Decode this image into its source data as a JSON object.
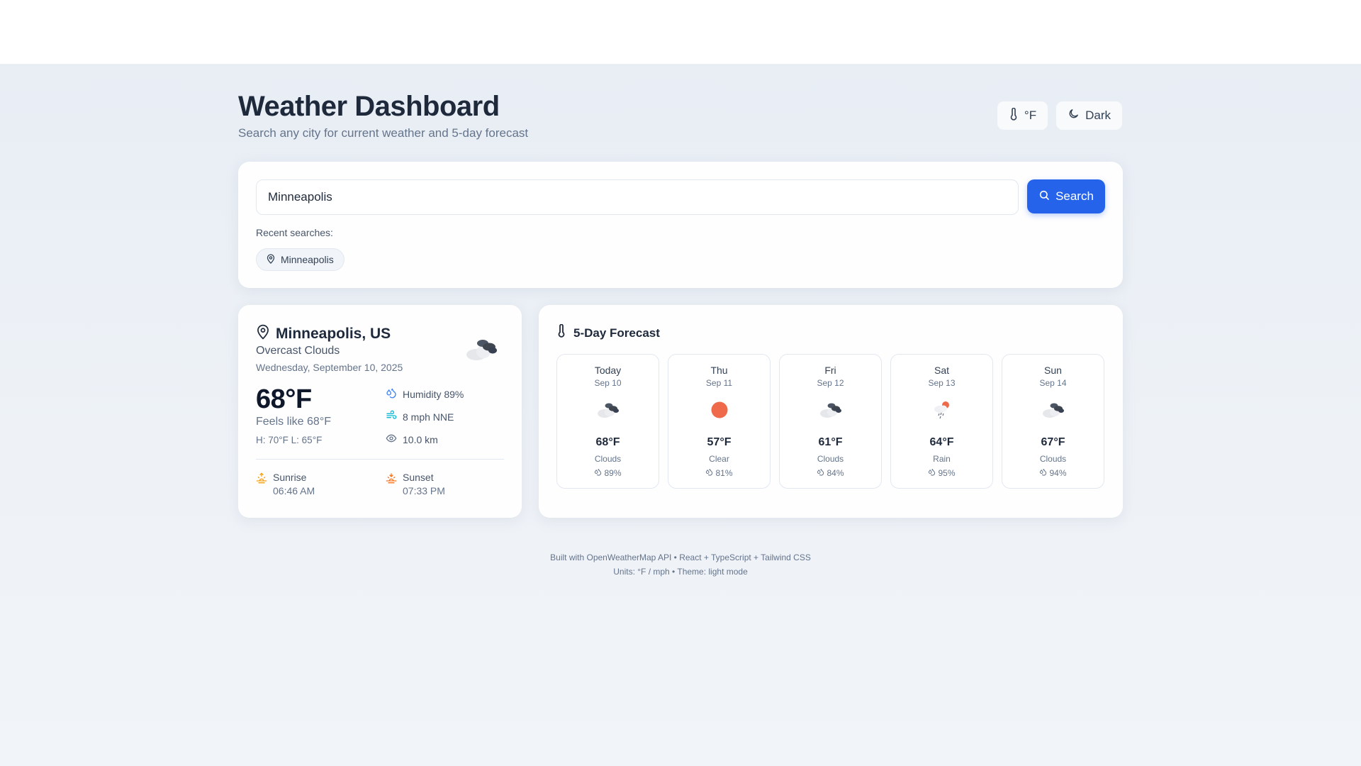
{
  "header": {
    "title": "Weather Dashboard",
    "subtitle": "Search any city for current weather and 5-day forecast",
    "unit_button": "°F",
    "theme_button": "Dark"
  },
  "search": {
    "value": "Minneapolis",
    "button_label": "Search",
    "recent_label": "Recent searches:",
    "recent": [
      "Minneapolis"
    ]
  },
  "current": {
    "city": "Minneapolis, US",
    "description": "Overcast Clouds",
    "date": "Wednesday, September 10, 2025",
    "temperature": "68°F",
    "feels_like": "Feels like 68°F",
    "high_low": "H: 70°F L: 65°F",
    "humidity": "Humidity 89%",
    "wind": "8 mph NNE",
    "visibility": "10.0 km",
    "sunrise_label": "Sunrise",
    "sunrise_time": "06:46 AM",
    "sunset_label": "Sunset",
    "sunset_time": "07:33 PM",
    "icon": "overcast-clouds-icon"
  },
  "forecast": {
    "title": "5-Day Forecast",
    "days": [
      {
        "name": "Today",
        "date": "Sep 10",
        "temp": "68°F",
        "condition": "Clouds",
        "humidity": "89%",
        "icon": "clouds-icon"
      },
      {
        "name": "Thu",
        "date": "Sep 11",
        "temp": "57°F",
        "condition": "Clear",
        "humidity": "81%",
        "icon": "sun-icon"
      },
      {
        "name": "Fri",
        "date": "Sep 12",
        "temp": "61°F",
        "condition": "Clouds",
        "humidity": "84%",
        "icon": "clouds-icon"
      },
      {
        "name": "Sat",
        "date": "Sep 13",
        "temp": "64°F",
        "condition": "Rain",
        "humidity": "95%",
        "icon": "rain-icon"
      },
      {
        "name": "Sun",
        "date": "Sep 14",
        "temp": "67°F",
        "condition": "Clouds",
        "humidity": "94%",
        "icon": "clouds-icon"
      }
    ]
  },
  "footer": {
    "line1": "Built with OpenWeatherMap API • React + TypeScript + Tailwind CSS",
    "line2": "Units: °F / mph • Theme: light mode"
  },
  "colors": {
    "accent": "#2563eb",
    "sun": "#ee6a4a",
    "sunrise": "#f59e0b",
    "sunset": "#f97316"
  }
}
